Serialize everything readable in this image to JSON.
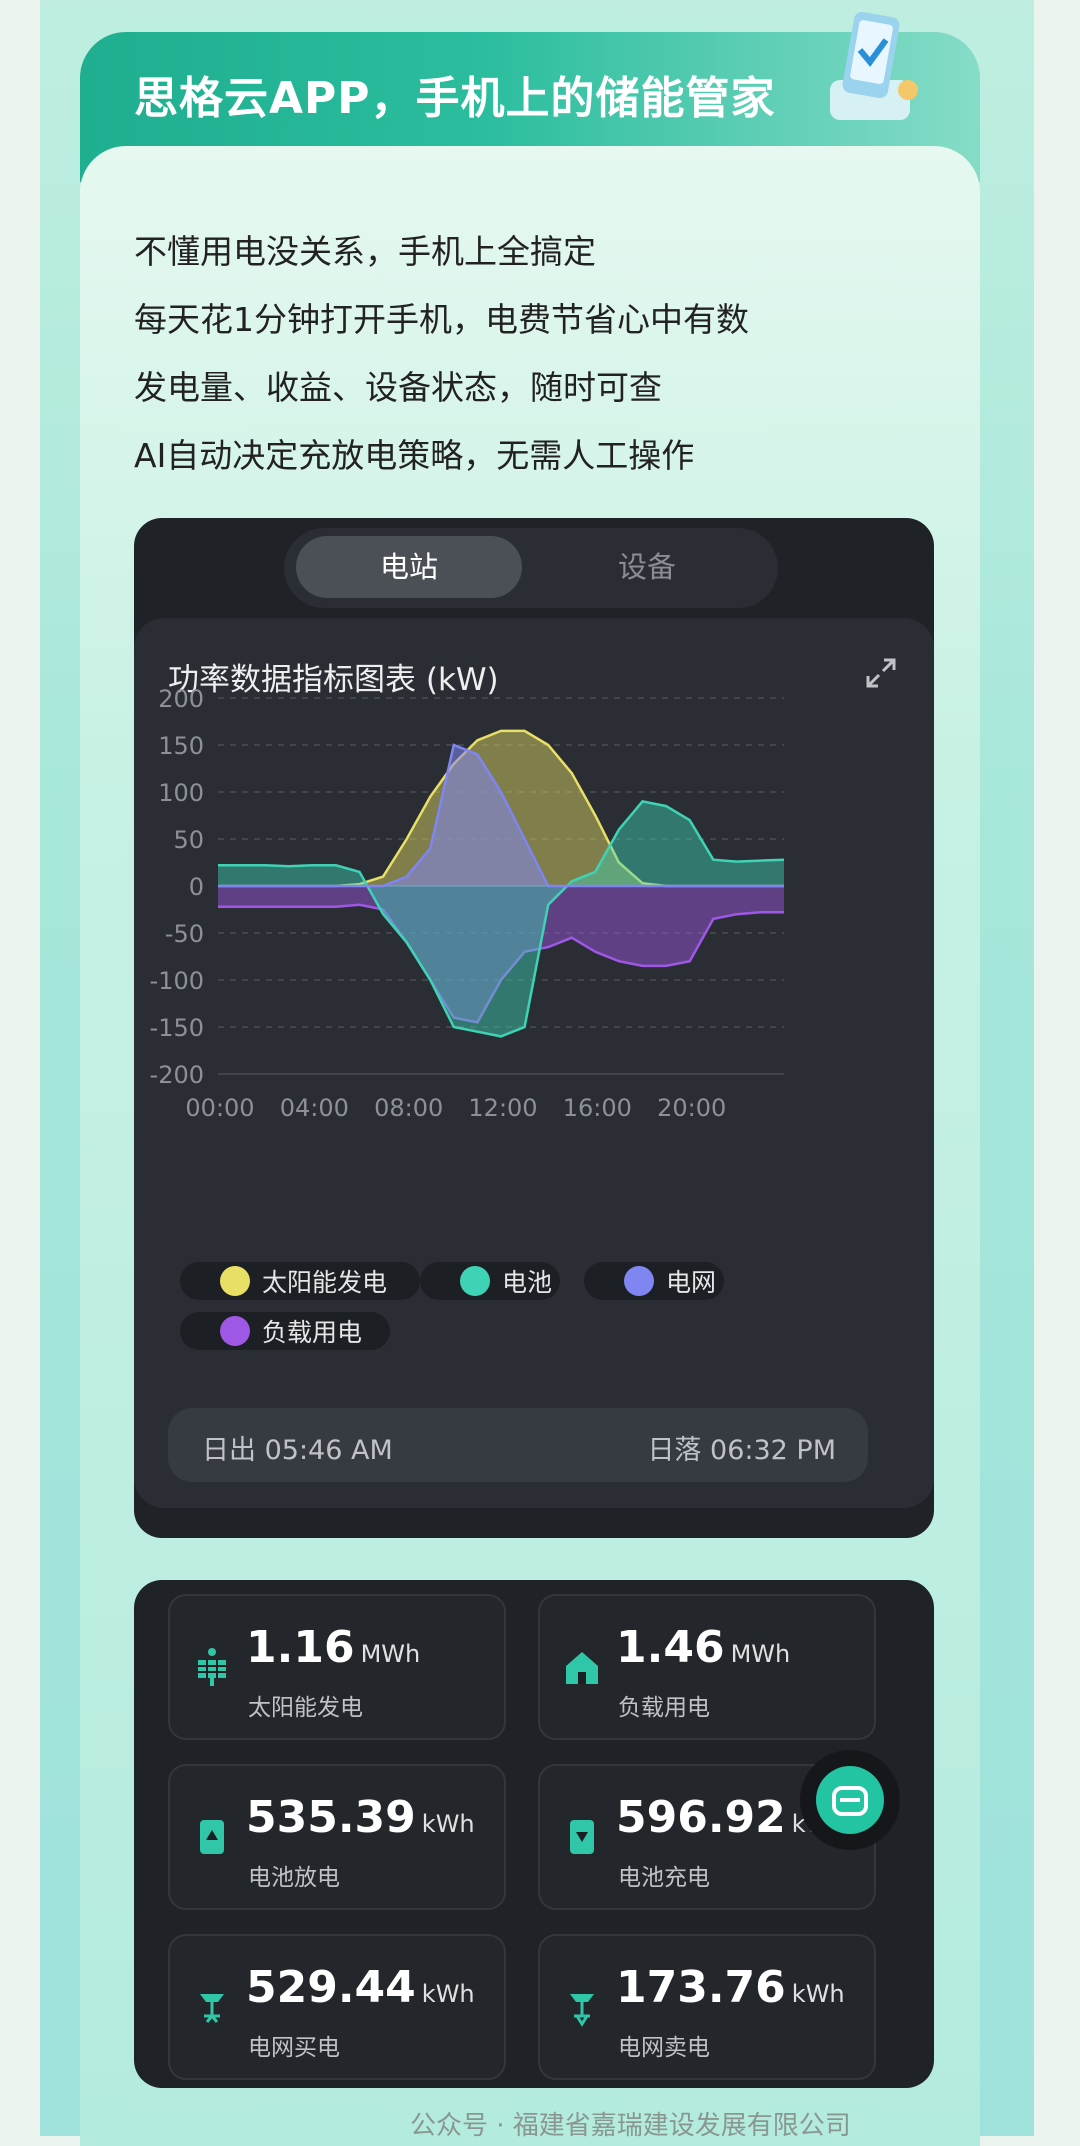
{
  "header": {
    "title": "思格云APP，手机上的储能管家"
  },
  "intro": {
    "lines": [
      "不懂用电没关系，手机上全搞定",
      "每天花1分钟打开手机，电费节省心中有数",
      "发电量、收益、设备状态，随时可查",
      "AI自动决定充放电策略，无需人工操作"
    ]
  },
  "tabs": {
    "station": "电站",
    "device": "设备"
  },
  "chart": {
    "title": "功率数据指标图表 (kW)",
    "expand_icon": "expand-icon"
  },
  "legend": [
    {
      "label": "太阳能发电",
      "color": "#e8e066"
    },
    {
      "label": "电池",
      "color": "#3fd3b6"
    },
    {
      "label": "电网",
      "color": "#7f86f2"
    },
    {
      "label": "负载用电",
      "color": "#9f57e6"
    }
  ],
  "sun": {
    "sunrise": "日出 05:46 AM",
    "sunset": "日落 06:32 PM"
  },
  "stats": [
    {
      "value": "1.16",
      "unit": "MWh",
      "label": "太阳能发电",
      "icon": "solar-panel-icon"
    },
    {
      "value": "1.46",
      "unit": "MWh",
      "label": "负载用电",
      "icon": "house-icon"
    },
    {
      "value": "535.39",
      "unit": "kWh",
      "label": "电池放电",
      "icon": "battery-discharge-icon"
    },
    {
      "value": "596.92",
      "unit": "kW",
      "label": "电池充电",
      "icon": "battery-charge-icon"
    },
    {
      "value": "529.44",
      "unit": "kWh",
      "label": "电网买电",
      "icon": "grid-tower-icon"
    },
    {
      "value": "173.76",
      "unit": "kWh",
      "label": "电网卖电",
      "icon": "grid-tower-sell-icon"
    }
  ],
  "watermark": "公众号 · 福建省嘉瑞建设发展有限公司",
  "chart_data": {
    "type": "area",
    "title": "功率数据指标图表 (kW)",
    "ylim": [
      -200,
      200
    ],
    "yticks": [
      "200",
      "150",
      "100",
      "50",
      "0",
      "-50",
      "-100",
      "-150",
      "-200"
    ],
    "xticks": [
      "00:00",
      "04:00",
      "08:00",
      "12:00",
      "16:00",
      "20:00"
    ],
    "x": [
      0,
      1,
      2,
      3,
      4,
      5,
      6,
      7,
      8,
      9,
      10,
      11,
      12,
      13,
      14,
      15,
      16,
      17,
      18,
      19,
      20,
      21,
      22,
      23,
      24
    ],
    "series": [
      {
        "name": "太阳能发电",
        "values": [
          0,
          0,
          0,
          0,
          0,
          0,
          2,
          10,
          50,
          95,
          130,
          155,
          165,
          165,
          150,
          120,
          75,
          25,
          3,
          0,
          0,
          0,
          0,
          0,
          0
        ]
      },
      {
        "name": "电池",
        "values": [
          22,
          22,
          22,
          21,
          22,
          22,
          15,
          -30,
          -60,
          -100,
          -150,
          -155,
          -160,
          -150,
          -20,
          5,
          15,
          60,
          90,
          85,
          70,
          28,
          26,
          27,
          28
        ]
      },
      {
        "name": "电网",
        "values": [
          0,
          0,
          0,
          0,
          0,
          0,
          0,
          0,
          10,
          40,
          150,
          140,
          100,
          50,
          0,
          0,
          0,
          0,
          0,
          0,
          0,
          0,
          0,
          0,
          0
        ]
      },
      {
        "name": "负载用电",
        "values": [
          -22,
          -22,
          -22,
          -22,
          -22,
          -22,
          -20,
          -25,
          -60,
          -100,
          -140,
          -145,
          -100,
          -70,
          -65,
          -55,
          -70,
          -80,
          -85,
          -85,
          -80,
          -35,
          -30,
          -28,
          -28
        ]
      }
    ]
  }
}
